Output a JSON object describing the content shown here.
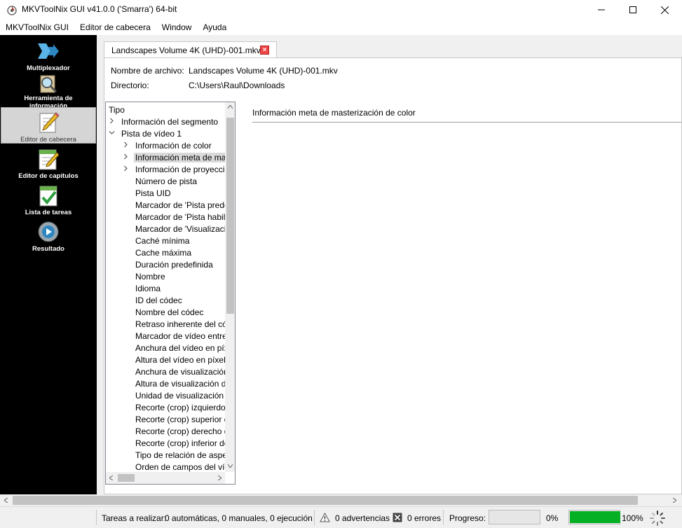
{
  "window": {
    "title": "MKVToolNix GUI v41.0.0 ('Smarra') 64-bit"
  },
  "menu": [
    "MKVToolNix GUI",
    "Editor de cabecera",
    "Window",
    "Ayuda"
  ],
  "sidebar": {
    "items": [
      {
        "label1": "Multiplexador",
        "label2": "",
        "icon": "multiplexer-icon"
      },
      {
        "label1": "Herramienta de",
        "label2": "información",
        "icon": "info-tool-icon"
      },
      {
        "label1": "Editor de cabecera",
        "label2": "",
        "icon": "header-editor-icon",
        "active": true
      },
      {
        "label1": "Editor de capítulos",
        "label2": "",
        "icon": "chapter-editor-icon"
      },
      {
        "label1": "Lista de tareas",
        "label2": "",
        "icon": "job-queue-icon"
      },
      {
        "label1": "Resultado",
        "label2": "",
        "icon": "job-output-icon"
      }
    ]
  },
  "tab": {
    "label": "Landscapes Volume 4K (UHD)-001.mkv"
  },
  "file_info": {
    "filename_label": "Nombre de archivo:",
    "filename_value": "Landscapes Volume 4K (UHD)-001.mkv",
    "dir_label": "Directorio:",
    "dir_value": "C:\\Users\\Raul\\Downloads"
  },
  "tree": {
    "header": "Tipo",
    "rows": [
      {
        "text": "Información del segmento",
        "level": 0,
        "arrow": "collapsed"
      },
      {
        "text": "Pista de vídeo 1",
        "level": 0,
        "arrow": "expanded"
      },
      {
        "text": "Información de color",
        "level": 1,
        "arrow": "collapsed"
      },
      {
        "text": "Información meta de masterización de color",
        "level": 1,
        "arrow": "collapsed",
        "selected": true
      },
      {
        "text": "Información de proyección de vídeo",
        "level": 1,
        "arrow": "collapsed"
      },
      {
        "text": "Número de pista",
        "level": 1
      },
      {
        "text": "Pista UID",
        "level": 1
      },
      {
        "text": "Marcador de 'Pista predeterminada'",
        "level": 1
      },
      {
        "text": "Marcador de 'Pista habilitada'",
        "level": 1
      },
      {
        "text": "Marcador de 'Visualización forzada'",
        "level": 1
      },
      {
        "text": "Caché mínima",
        "level": 1
      },
      {
        "text": "Cache máxima",
        "level": 1
      },
      {
        "text": "Duración predefinida",
        "level": 1
      },
      {
        "text": "Nombre",
        "level": 1
      },
      {
        "text": "Idioma",
        "level": 1
      },
      {
        "text": "ID del códec",
        "level": 1
      },
      {
        "text": "Nombre del códec",
        "level": 1
      },
      {
        "text": "Retraso inherente del códec",
        "level": 1
      },
      {
        "text": "Marcador de vídeo entrelazado",
        "level": 1
      },
      {
        "text": "Anchura del vídeo en píxeles",
        "level": 1
      },
      {
        "text": "Altura del vídeo en píxeles",
        "level": 1
      },
      {
        "text": "Anchura de visualización del vídeo",
        "level": 1
      },
      {
        "text": "Altura de visualización del vídeo",
        "level": 1
      },
      {
        "text": "Unidad de visualización",
        "level": 1
      },
      {
        "text": "Recorte (crop) izquierdo",
        "level": 1
      },
      {
        "text": "Recorte (crop) superior del vídeo",
        "level": 1
      },
      {
        "text": "Recorte (crop) derecho del vídeo",
        "level": 1
      },
      {
        "text": "Recorte (crop) inferior del vídeo",
        "level": 1
      },
      {
        "text": "Tipo de relación de aspecto",
        "level": 1
      },
      {
        "text": "Orden de campos del vídeo",
        "level": 1
      }
    ]
  },
  "right_panel": {
    "title": "Información meta de masterización de color"
  },
  "status": {
    "tasks_label": "Tareas a realizar:",
    "tasks_value": "0 automáticas, 0 manuales, 0 ejecución",
    "warnings": "0 advertencias",
    "errors": "0 errores",
    "progress_label": "Progreso:",
    "progress_current": "0%",
    "progress_total": "100%",
    "progress_current_fraction": 0,
    "progress_total_fraction": 1.0
  },
  "colors": {
    "sidebar_bg": "#000000",
    "progress_fill": "#06b025",
    "tab_close": "#e44444"
  }
}
